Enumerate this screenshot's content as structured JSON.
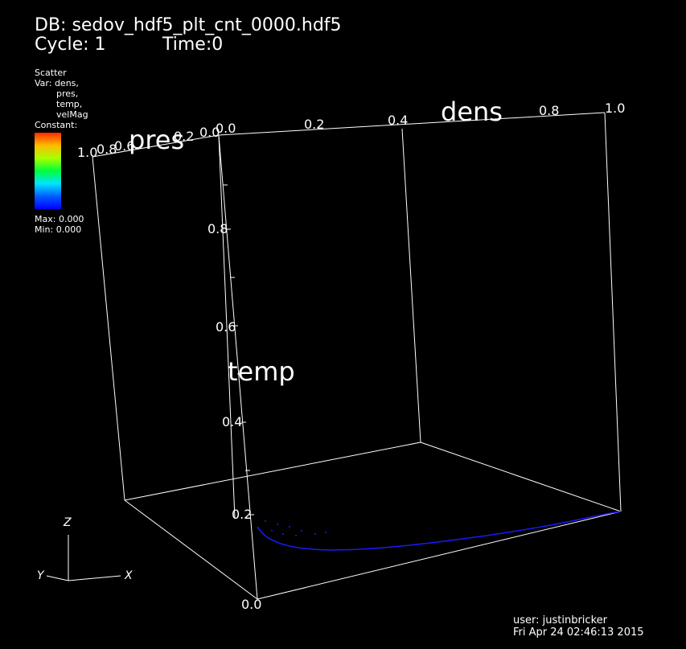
{
  "header": {
    "db": "DB: sedov_hdf5_plt_cnt_0000.hdf5",
    "cycle": "Cycle: 1",
    "time": "Time:0"
  },
  "legend": {
    "plot_type": "Scatter",
    "var_label": "Var: dens,",
    "vars": [
      "pres,",
      "temp,",
      "velMag"
    ],
    "constant": "Constant:",
    "max": "Max: 0.000",
    "min": "Min: 0.000"
  },
  "axes": {
    "dens": "dens",
    "pres": "pres",
    "temp": "temp",
    "triad": {
      "x": "X",
      "y": "Y",
      "z": "Z"
    },
    "temp_ticks": [
      "0.0",
      "0.2",
      "0.4",
      "0.6",
      "0.8"
    ],
    "dens_ticks": [
      "0.0",
      "0.2",
      "0.4",
      "0.8",
      "1.0"
    ],
    "pres_ticks": [
      "1.0",
      "0.8",
      "0.6",
      "0.2",
      "0.0"
    ]
  },
  "footer": {
    "user": "user: justinbricker",
    "date": "Fri Apr 24 02:46:13 2015"
  },
  "colors": {
    "curve": "#1a1aff",
    "frame": "#ffffff"
  }
}
